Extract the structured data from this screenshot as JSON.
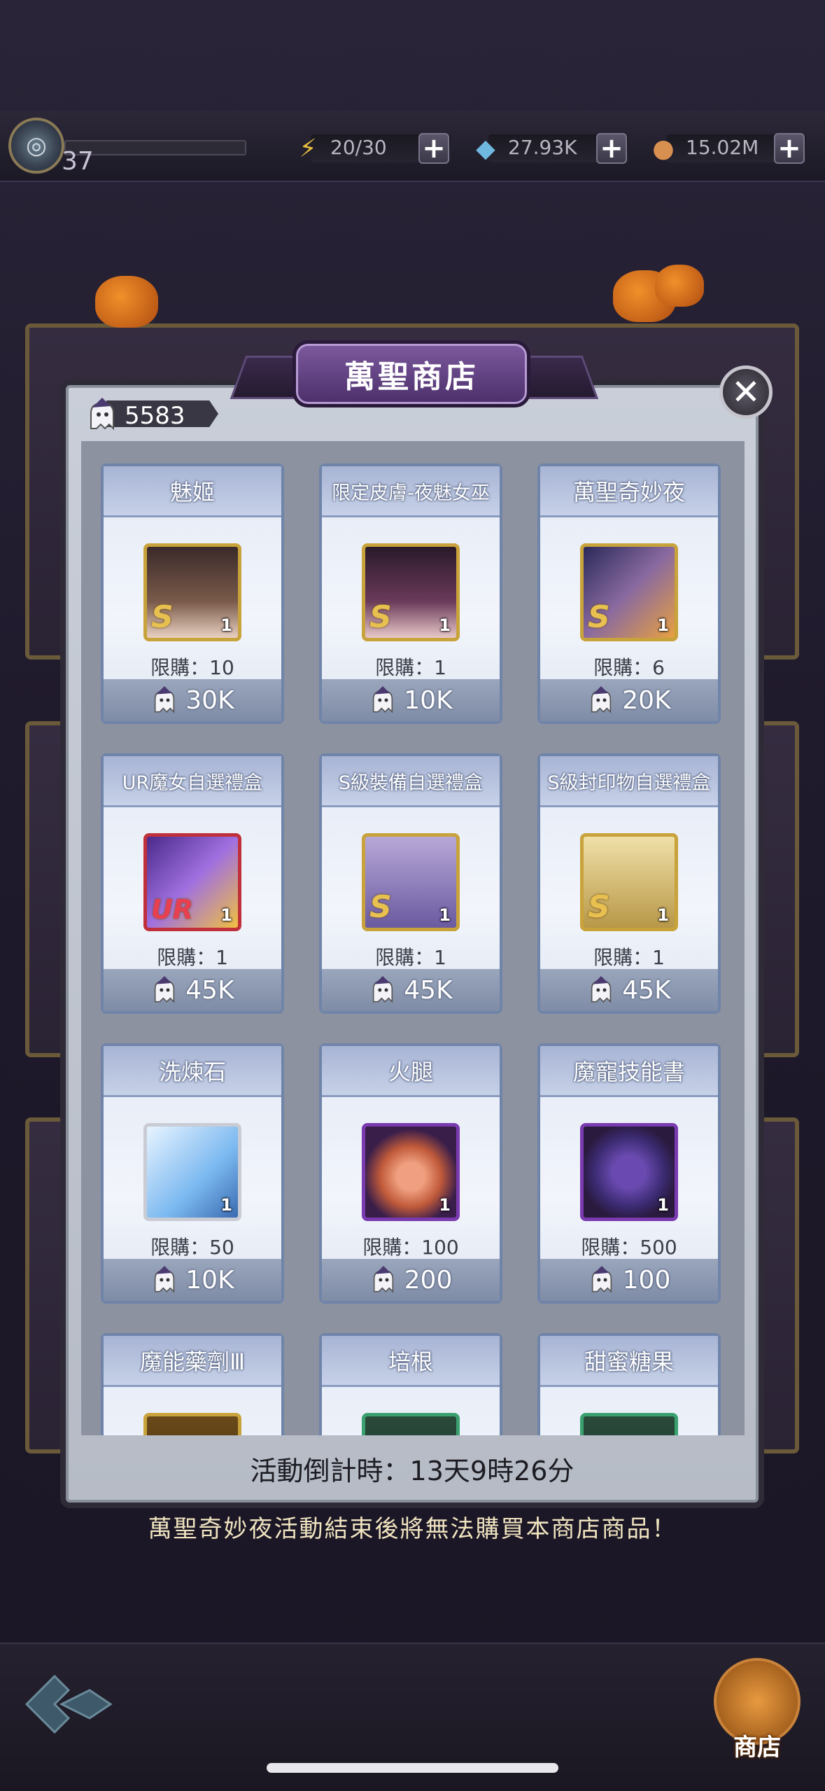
{
  "status_bar": {
    "level": "37",
    "energy": "20/30",
    "diamonds": "27.93K",
    "coins": "15.02M"
  },
  "shop": {
    "title": "萬聖商店",
    "currency_amount": "5583",
    "close_icon": "close-icon",
    "items": [
      {
        "name": "魅姬",
        "limit": "限購：10",
        "price": "30K",
        "qty": "1",
        "rank": "S",
        "frame": "gold",
        "icon": "character-portrait-icon"
      },
      {
        "name": "限定皮膚-夜魅女巫",
        "limit": "限購：1",
        "price": "10K",
        "qty": "1",
        "rank": "S",
        "frame": "gold",
        "icon": "skin-portrait-icon"
      },
      {
        "name": "萬聖奇妙夜",
        "limit": "限購：6",
        "price": "20K",
        "qty": "1",
        "rank": "S",
        "frame": "gold",
        "icon": "card-pack-icon"
      },
      {
        "name": "UR魔女自選禮盒",
        "limit": "限購：1",
        "price": "45K",
        "qty": "1",
        "rank": "UR",
        "frame": "red",
        "icon": "gift-box-icon"
      },
      {
        "name": "S級裝備自選禮盒",
        "limit": "限購：1",
        "price": "45K",
        "qty": "1",
        "rank": "S",
        "frame": "gold",
        "icon": "equipment-chest-icon"
      },
      {
        "name": "S級封印物自選禮盒",
        "limit": "限購：1",
        "price": "45K",
        "qty": "1",
        "rank": "S",
        "frame": "gold",
        "icon": "seal-chest-icon"
      },
      {
        "name": "洗煉石",
        "limit": "限購：50",
        "price": "10K",
        "qty": "1",
        "rank": "",
        "frame": "gray",
        "icon": "refining-stone-icon"
      },
      {
        "name": "火腿",
        "limit": "限購：100",
        "price": "200",
        "qty": "1",
        "rank": "",
        "frame": "purple",
        "icon": "ham-icon"
      },
      {
        "name": "魔寵技能書",
        "limit": "限購：500",
        "price": "100",
        "qty": "1",
        "rank": "",
        "frame": "purple",
        "icon": "skill-book-icon"
      },
      {
        "name": "魔能藥劑Ⅲ",
        "limit": "",
        "price": "",
        "qty": "",
        "rank": "",
        "frame": "gold",
        "icon": "potion-icon"
      },
      {
        "name": "培根",
        "limit": "",
        "price": "",
        "qty": "",
        "rank": "",
        "frame": "green",
        "icon": "bacon-icon"
      },
      {
        "name": "甜蜜糖果",
        "limit": "",
        "price": "",
        "qty": "",
        "rank": "",
        "frame": "green",
        "icon": "candy-icon"
      }
    ],
    "countdown": "活動倒計時：13天9時26分",
    "notice": "萬聖奇妙夜活動結束後將無法購買本商店商品！"
  },
  "bottom_nav": {
    "shop_label": "商店"
  },
  "colors": {
    "accent_purple": "#6b4a8c",
    "card_border": "#6f84a8",
    "frame_gold": "#c8a23a"
  }
}
